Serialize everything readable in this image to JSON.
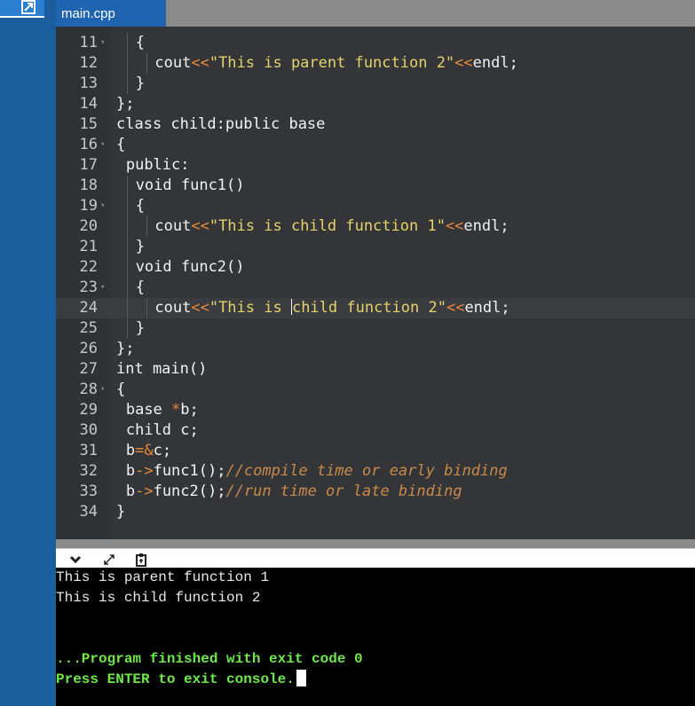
{
  "tab": {
    "label": "main.cpp"
  },
  "editor": {
    "lines": [
      {
        "n": "11",
        "fold": true,
        "indent": 2,
        "tokens": [
          {
            "t": "{",
            "c": ""
          }
        ]
      },
      {
        "n": "12",
        "fold": false,
        "indent": 4,
        "tokens": [
          {
            "t": "cout",
            "c": ""
          },
          {
            "t": "<<",
            "c": "op"
          },
          {
            "t": "\"This is parent function 2\"",
            "c": "str"
          },
          {
            "t": "<<",
            "c": "op"
          },
          {
            "t": "endl;",
            "c": ""
          }
        ]
      },
      {
        "n": "13",
        "fold": false,
        "indent": 2,
        "tokens": [
          {
            "t": "}",
            "c": ""
          }
        ]
      },
      {
        "n": "14",
        "fold": false,
        "indent": 0,
        "tokens": [
          {
            "t": "};",
            "c": ""
          }
        ]
      },
      {
        "n": "15",
        "fold": false,
        "indent": 0,
        "tokens": [
          {
            "t": "class child:public base",
            "c": ""
          }
        ]
      },
      {
        "n": "16",
        "fold": true,
        "indent": 0,
        "tokens": [
          {
            "t": "{",
            "c": ""
          }
        ]
      },
      {
        "n": "17",
        "fold": false,
        "indent": 1,
        "tokens": [
          {
            "t": "public:",
            "c": ""
          }
        ]
      },
      {
        "n": "18",
        "fold": false,
        "indent": 2,
        "tokens": [
          {
            "t": "void func1()",
            "c": ""
          }
        ]
      },
      {
        "n": "19",
        "fold": true,
        "indent": 2,
        "tokens": [
          {
            "t": "{",
            "c": ""
          }
        ]
      },
      {
        "n": "20",
        "fold": false,
        "indent": 4,
        "tokens": [
          {
            "t": "cout",
            "c": ""
          },
          {
            "t": "<<",
            "c": "op"
          },
          {
            "t": "\"This is child function 1\"",
            "c": "str"
          },
          {
            "t": "<<",
            "c": "op"
          },
          {
            "t": "endl;",
            "c": ""
          }
        ]
      },
      {
        "n": "21",
        "fold": false,
        "indent": 2,
        "tokens": [
          {
            "t": "}",
            "c": ""
          }
        ]
      },
      {
        "n": "22",
        "fold": false,
        "indent": 2,
        "tokens": [
          {
            "t": "void func2()",
            "c": ""
          }
        ]
      },
      {
        "n": "23",
        "fold": true,
        "indent": 2,
        "tokens": [
          {
            "t": "{",
            "c": ""
          }
        ]
      },
      {
        "n": "24",
        "fold": false,
        "indent": 4,
        "active": true,
        "tokens": [
          {
            "t": "cout",
            "c": ""
          },
          {
            "t": "<<",
            "c": "op"
          },
          {
            "t": "\"This is ",
            "c": "str"
          },
          {
            "t": "|",
            "c": "cursor"
          },
          {
            "t": "child function 2\"",
            "c": "str"
          },
          {
            "t": "<<",
            "c": "op"
          },
          {
            "t": "endl;",
            "c": ""
          }
        ]
      },
      {
        "n": "25",
        "fold": false,
        "indent": 2,
        "tokens": [
          {
            "t": "}",
            "c": ""
          }
        ]
      },
      {
        "n": "26",
        "fold": false,
        "indent": 0,
        "tokens": [
          {
            "t": "};",
            "c": ""
          }
        ]
      },
      {
        "n": "27",
        "fold": false,
        "indent": 0,
        "tokens": [
          {
            "t": "int main()",
            "c": ""
          }
        ]
      },
      {
        "n": "28",
        "fold": true,
        "indent": 0,
        "tokens": [
          {
            "t": "{",
            "c": ""
          }
        ]
      },
      {
        "n": "29",
        "fold": false,
        "indent": 1,
        "tokens": [
          {
            "t": "base ",
            "c": ""
          },
          {
            "t": "*",
            "c": "op"
          },
          {
            "t": "b;",
            "c": ""
          }
        ]
      },
      {
        "n": "30",
        "fold": false,
        "indent": 1,
        "tokens": [
          {
            "t": "child c;",
            "c": ""
          }
        ]
      },
      {
        "n": "31",
        "fold": false,
        "indent": 1,
        "tokens": [
          {
            "t": "b",
            "c": ""
          },
          {
            "t": "=&",
            "c": "op"
          },
          {
            "t": "c;",
            "c": ""
          }
        ]
      },
      {
        "n": "32",
        "fold": false,
        "indent": 1,
        "tokens": [
          {
            "t": "b",
            "c": ""
          },
          {
            "t": "->",
            "c": "op"
          },
          {
            "t": "func1();",
            "c": ""
          },
          {
            "t": "//compile time or early binding",
            "c": "cmt"
          }
        ]
      },
      {
        "n": "33",
        "fold": false,
        "indent": 1,
        "tokens": [
          {
            "t": "b",
            "c": ""
          },
          {
            "t": "->",
            "c": "op"
          },
          {
            "t": "func2();",
            "c": ""
          },
          {
            "t": "//run time or late binding",
            "c": "cmt"
          }
        ]
      },
      {
        "n": "34",
        "fold": false,
        "indent": 0,
        "tokens": [
          {
            "t": "}",
            "c": ""
          }
        ]
      }
    ]
  },
  "toolbar": {
    "collapse_icon": "chevron-down-icon",
    "expand_icon": "expand-arrows-icon",
    "copy_icon": "clipboard-icon"
  },
  "console": {
    "output_line_1": "This is parent function 1",
    "output_line_2": "This is child function 2",
    "finish_message": "...Program finished with exit code 0",
    "prompt": "Press ENTER to exit console."
  },
  "colors": {
    "editor_bg": "#333538",
    "operator": "#e98a3b",
    "string": "#e6d36a",
    "comment": "#c98a4a",
    "console_green": "#6ee84a"
  }
}
